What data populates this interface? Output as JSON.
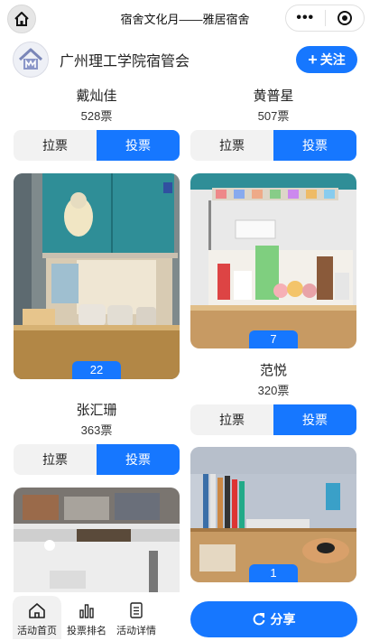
{
  "nav": {
    "title": "宿舍文化月——雅居宿舍",
    "home_icon": "home-icon",
    "more_label": "•••",
    "capsule_icons": [
      "more-dots-icon",
      "target-close-icon"
    ]
  },
  "org": {
    "name": "广州理工学院宿管会",
    "logo_icon": "org-logo",
    "follow_label": "关注"
  },
  "actions": {
    "pull_label": "拉票",
    "vote_label": "投票"
  },
  "entries": {
    "left": [
      {
        "name": "戴灿佳",
        "votes": "528票",
        "number": "22"
      },
      {
        "name": "张汇珊",
        "votes": "363票"
      }
    ],
    "right": [
      {
        "name": "黄普星",
        "votes": "507票",
        "number": "7"
      },
      {
        "name": "范悦",
        "votes": "320票",
        "number": "1"
      }
    ]
  },
  "bottom": {
    "tabs": [
      {
        "label": "活动首页",
        "icon": "home-icon"
      },
      {
        "label": "投票排名",
        "icon": "bar-chart-icon"
      },
      {
        "label": "活动详情",
        "icon": "document-icon"
      }
    ],
    "share_label": "分享"
  },
  "colors": {
    "accent": "#1677ff",
    "pull_bg": "#f2f2f2"
  }
}
